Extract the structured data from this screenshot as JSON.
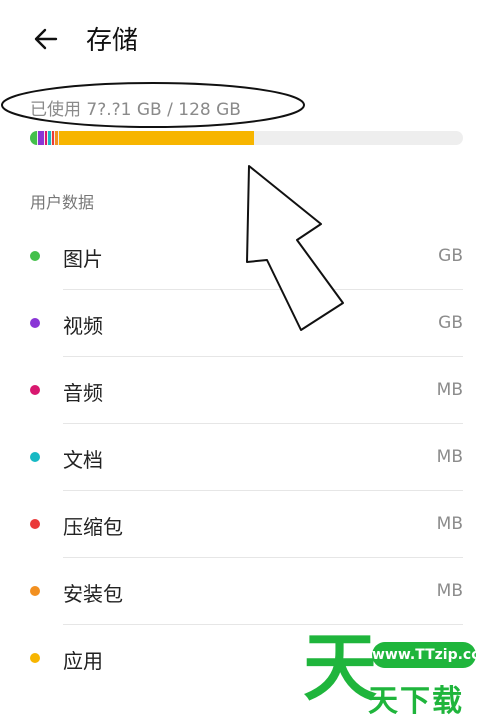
{
  "header": {
    "title": "存储"
  },
  "storage": {
    "used_label": "已使用 7?.?1 GB / 128 GB",
    "bar_segments": [
      {
        "name": "图片",
        "fraction": 0.016,
        "color": "#43c04b"
      },
      {
        "name": "视频",
        "fraction": 0.013,
        "color": "#8a35d6"
      },
      {
        "name": "音频",
        "fraction": 0.006,
        "color": "#d8186f"
      },
      {
        "name": "文档",
        "fraction": 0.006,
        "color": "#16b9c4"
      },
      {
        "name": "压缩包",
        "fraction": 0.006,
        "color": "#ea3a3a"
      },
      {
        "name": "安装包",
        "fraction": 0.006,
        "color": "#f29020"
      },
      {
        "name": "应用",
        "fraction": 0.45,
        "color": "#f7b500"
      }
    ],
    "bar_background": "#eeeeee"
  },
  "section_title": "用户数据",
  "items": [
    {
      "label": "图片",
      "size": "GB",
      "color": "#43c04b"
    },
    {
      "label": "视频",
      "size": "GB",
      "color": "#8a35d6"
    },
    {
      "label": "音频",
      "size": "MB",
      "color": "#d8186f"
    },
    {
      "label": "文档",
      "size": "MB",
      "color": "#16b9c4"
    },
    {
      "label": "压缩包",
      "size": "MB",
      "color": "#ea3a3a"
    },
    {
      "label": "安装包",
      "size": "MB",
      "color": "#f29020"
    },
    {
      "label": "应用",
      "size": "",
      "color": "#f7b500"
    }
  ],
  "watermark": {
    "badge": "www.TTzip.com",
    "big_char": "天",
    "text": "天下载"
  }
}
